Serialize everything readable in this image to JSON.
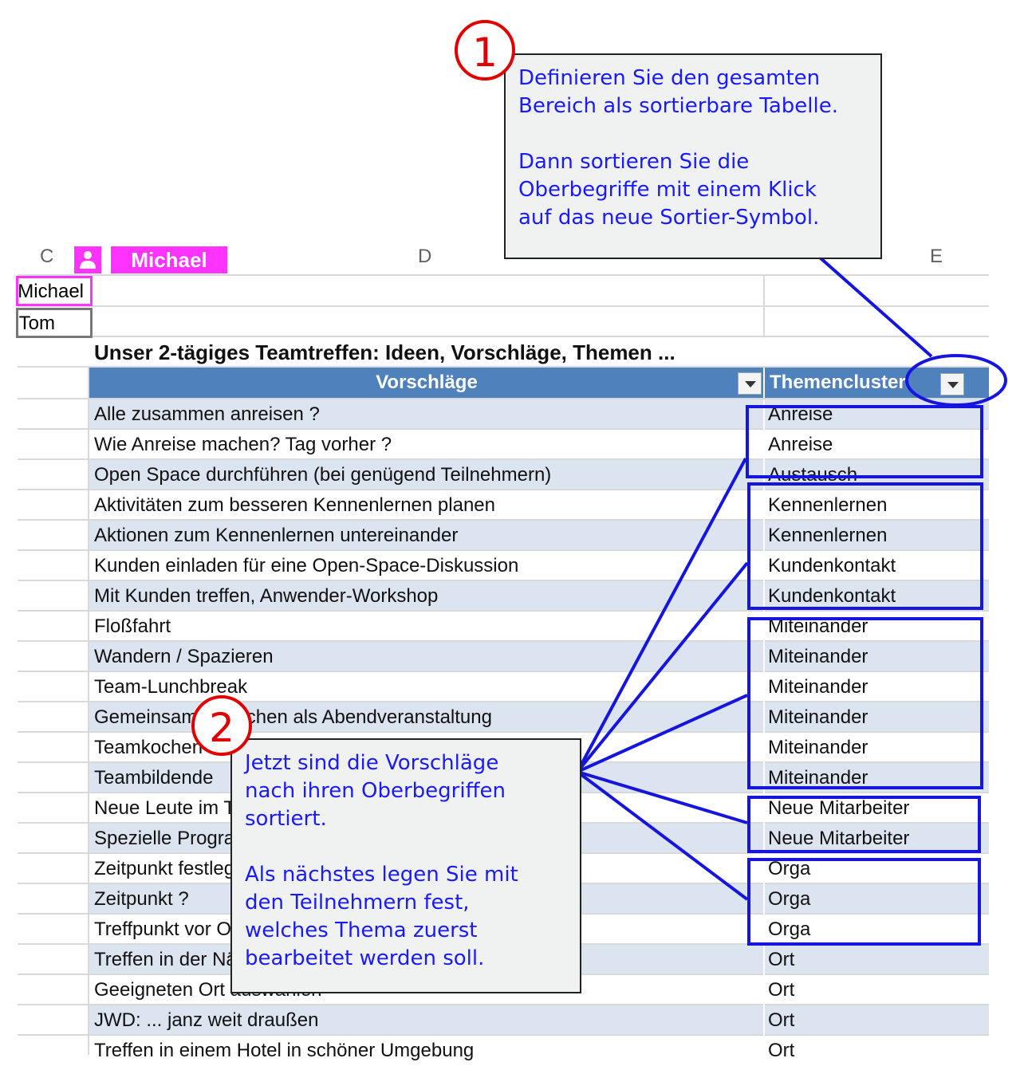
{
  "columns": {
    "c": "C",
    "d": "D",
    "e": "E"
  },
  "collaborator": {
    "icon": "user-icon",
    "name": "Michael",
    "color": "#ff33ff"
  },
  "name_cells": [
    "Michael",
    "Tom"
  ],
  "table": {
    "title": "Unser 2-tägiges Teamtreffen: Ideen, Vorschläge, Themen ...",
    "header_color": "#4f81bd",
    "stripe_color": "#dce4f0",
    "headers": [
      "Vorschläge",
      "Themencluster"
    ],
    "rows": [
      [
        "Alle zusammen anreisen ?",
        "Anreise"
      ],
      [
        "Wie Anreise machen? Tag vorher ?",
        "Anreise"
      ],
      [
        "Open Space durchführen (bei genügend Teilnehmern)",
        "Austausch"
      ],
      [
        "Aktivitäten zum besseren Kennenlernen planen",
        "Kennenlernen"
      ],
      [
        "Aktionen zum Kennenlernen untereinander",
        "Kennenlernen"
      ],
      [
        "Kunden einladen für eine Open-Space-Diskussion",
        "Kundenkontakt"
      ],
      [
        "Mit Kunden treffen, Anwender-Workshop",
        "Kundenkontakt"
      ],
      [
        "Floßfahrt",
        "Miteinander"
      ],
      [
        "Wandern / Spazieren",
        "Miteinander"
      ],
      [
        "Team-Lunchbreak",
        "Miteinander"
      ],
      [
        "Gemeinsames Kochen als Abendveranstaltung",
        "Miteinander"
      ],
      [
        "Teamkochen",
        "Miteinander"
      ],
      [
        "Teambildende",
        "Miteinander"
      ],
      [
        "Neue Leute im Team berücksichtigen",
        "Neue Mitarbeiter"
      ],
      [
        "Spezielle Programmpunkte, um Neue zu integrieren",
        "Neue Mitarbeiter"
      ],
      [
        "Zeitpunkt festlegen",
        "Orga"
      ],
      [
        "Zeitpunkt ?",
        "Orga"
      ],
      [
        "Treffpunkt vor Ort",
        "Orga"
      ],
      [
        "Treffen in der Nähe",
        "Ort"
      ],
      [
        "Geeigneten Ort auswählen",
        "Ort"
      ],
      [
        "JWD: ... janz weit draußen",
        "Ort"
      ],
      [
        "Treffen in einem Hotel in schöner Umgebung",
        "Ort"
      ]
    ]
  },
  "callout1": {
    "badge": "1",
    "lines1": [
      "Definieren Sie den gesamten",
      "Bereich als sortierbare Tabelle."
    ],
    "lines2": [
      "Dann sortieren Sie die",
      "Oberbegriffe mit einem Klick",
      "auf das neue Sortier-Symbol."
    ]
  },
  "callout2": {
    "badge": "2",
    "lines1": [
      "Jetzt sind die Vorschläge",
      "nach ihren Oberbegriffen",
      "sortiert."
    ],
    "lines2": [
      "Als nächstes legen Sie mit",
      "den Teilnehmern fest,",
      "welches Thema zuerst",
      "bearbeitet werden soll."
    ]
  },
  "annotation_color": "#1515dd"
}
